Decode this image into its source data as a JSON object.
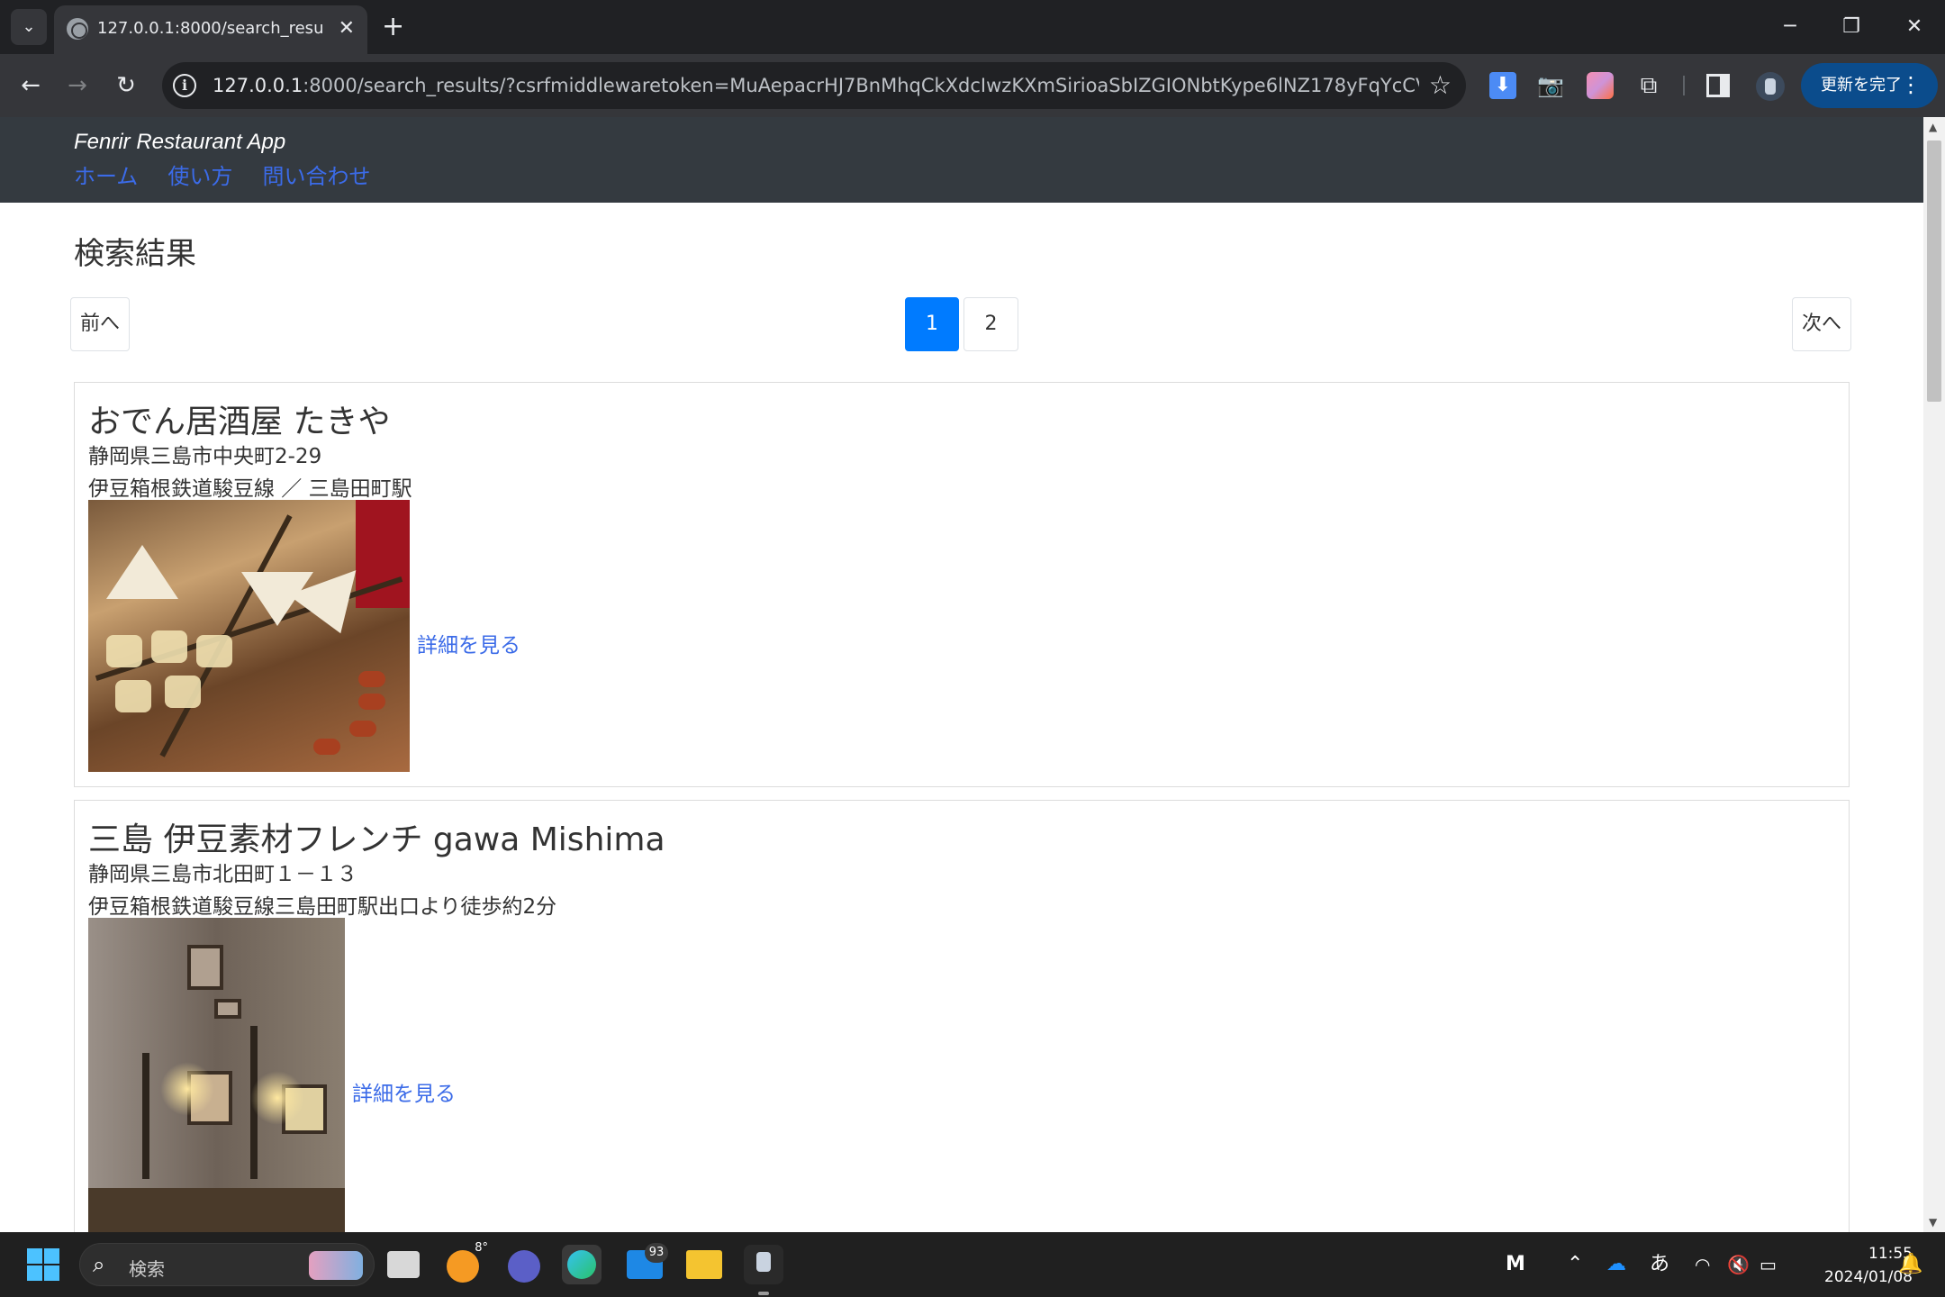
{
  "browser": {
    "tab_title": "127.0.0.1:8000/search_results/?c",
    "url_host": "127.0.0.1",
    "url_rest": ":8000/search_results/?csrfmiddlewaretoken=MuAepacrHJ7BnMhqCkXdcIwzKXmSirioaSbIZGIONbtKype6lNZ178yFqYcCVHyM&radius=...",
    "update_button": "更新を完了"
  },
  "site": {
    "brand": "Fenrir Restaurant App",
    "nav": [
      "ホーム",
      "使い方",
      "問い合わせ"
    ]
  },
  "page": {
    "heading": "検索結果",
    "pagination": {
      "prev": "前へ",
      "next": "次へ",
      "pages": [
        "1",
        "2"
      ],
      "current": "1"
    }
  },
  "results": [
    {
      "name": "おでん居酒屋 たきや",
      "address": "静岡県三島市中央町2-29",
      "access": "伊豆箱根鉄道駿豆線 ／ 三島田町駅",
      "detail_link": "詳細を見る"
    },
    {
      "name": "三島 伊豆素材フレンチ gawa Mishima",
      "address": "静岡県三島市北田町１－１３",
      "access": "伊豆箱根鉄道駿豆線三島田町駅出口より徒歩約2分",
      "detail_link": "詳細を見る"
    }
  ],
  "taskbar": {
    "search_placeholder": "検索",
    "weather_temp": "8°",
    "mail_badge": "93",
    "ime": "あ",
    "time": "11:55",
    "date": "2024/01/08"
  },
  "colors": {
    "header_bg": "#343a40",
    "link": "#3b6be8",
    "active_page": "#007bff",
    "update_button": "#0b4c8c"
  }
}
